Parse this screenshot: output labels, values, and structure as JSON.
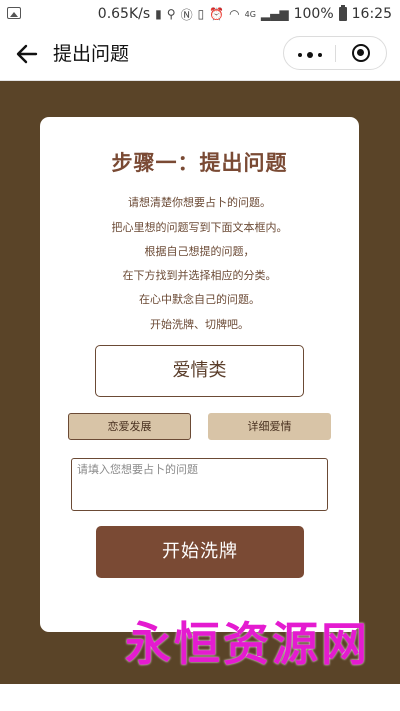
{
  "status_bar": {
    "speed": "0.65K/s",
    "battery": "100%",
    "time": "16:25",
    "network": "4G"
  },
  "nav": {
    "title": "提出问题"
  },
  "card": {
    "title": "步骤一：提出问题",
    "instructions": [
      "请想清楚你想要占卜的问题。",
      "把心里想的问题写到下面文本框内。",
      "根据自己想提的问题，",
      "在下方找到并选择相应的分类。",
      "在心中默念自己的问题。",
      "开始洗牌、切牌吧。"
    ],
    "category": "爱情类",
    "sub_categories": [
      "恋爱发展",
      "详细爱情"
    ],
    "question_placeholder": "请填入您想要占卜的问题",
    "shuffle_label": "开始洗牌"
  },
  "watermark": "永恒资源网",
  "colors": {
    "background": "#5a4428",
    "accent": "#7a4a34",
    "sub_button": "#d8c4a7",
    "watermark": "#e41bd0"
  }
}
